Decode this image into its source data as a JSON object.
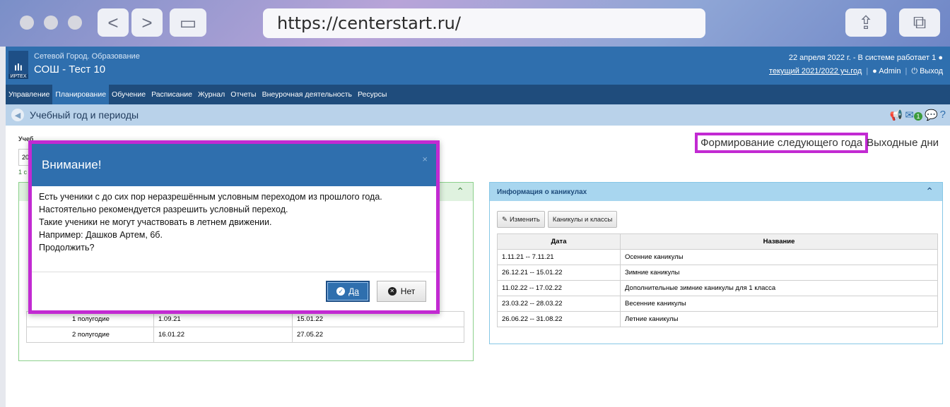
{
  "browser": {
    "url": "https://centerstart.ru/",
    "back_glyph": "<",
    "forward_glyph": ">",
    "sidebar_glyph": "▭",
    "share_glyph": "⇪",
    "tabs_glyph": "⧉"
  },
  "app": {
    "org_subtitle": "Сетевой Город. Образование",
    "org_name": "СОШ - Тест 10",
    "logo_text": "ИРТЕХ",
    "status_line": "22 апреля 2022 г. - В системе работает 1",
    "year_info": "текущий 2021/2022 уч.год",
    "user": "Admin",
    "logout": "Выход"
  },
  "menu": {
    "items": [
      "Управление",
      "Планирование",
      "Обучение",
      "Расписание",
      "Журнал",
      "Отчеты",
      "Внеурочная деятельность",
      "Ресурсы"
    ],
    "active": "Планирование"
  },
  "page": {
    "title": "Учебный год и периоды",
    "year_label": "Учеб",
    "year_value": "20",
    "year_note": "1 с"
  },
  "links": {
    "next_year": "Формирование следующего года",
    "weekends": "Выходные дни"
  },
  "periods_table": {
    "rows": [
      [
        "1 полугодие",
        "1.09.21",
        "15.01.22"
      ],
      [
        "2 полугодие",
        "16.01.22",
        "27.05.22"
      ]
    ]
  },
  "holidays_panel": {
    "title": "Информация о каникулах",
    "edit_button": "Изменить",
    "classes_button": "Каникулы и классы",
    "columns": [
      "Дата",
      "Название"
    ],
    "rows": [
      [
        "1.11.21 -- 7.11.21",
        "Осенние каникулы"
      ],
      [
        "26.12.21 -- 15.01.22",
        "Зимние каникулы"
      ],
      [
        "11.02.22 -- 17.02.22",
        "Дополнительные зимние каникулы для 1 класса"
      ],
      [
        "23.03.22 -- 28.03.22",
        "Весенние каникулы"
      ],
      [
        "26.06.22 -- 31.08.22",
        "Летние каникулы"
      ]
    ]
  },
  "modal": {
    "title": "Внимание!",
    "close": "×",
    "lines": [
      "Есть ученики с до сих пор неразрешённым условным переходом из прошлого года.",
      "Настоятельно рекомендуется разрешить условный переход.",
      "Такие ученики не могут участвовать в летнем движении.",
      "Например: Дашков Артем, 6б.",
      "Продолжить?"
    ],
    "yes_label": "Да",
    "no_label": "Нет"
  },
  "colors": {
    "header": "#2f6fae",
    "menu": "#1f4c7c",
    "highlight": "#c22ad2",
    "notification_badge": "1"
  }
}
